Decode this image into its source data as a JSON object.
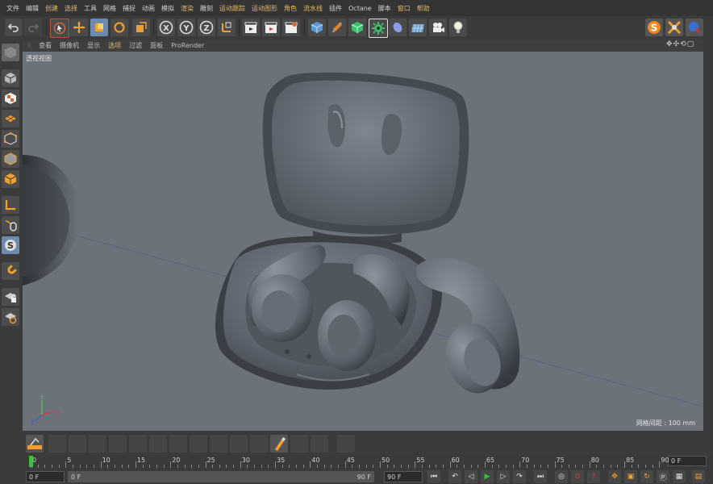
{
  "menu": [
    "文件",
    "编辑",
    "创建",
    "选择",
    "工具",
    "网格",
    "捕捉",
    "动画",
    "模拟",
    "渲染",
    "雕刻",
    "运动跟踪",
    "运动图形",
    "角色",
    "流水线",
    "插件",
    "Octane",
    "脚本",
    "窗口",
    "帮助"
  ],
  "menu_highlight": [
    "创建",
    "选择",
    "渲染",
    "运动跟踪",
    "运动图形",
    "角色",
    "流水线",
    "窗口",
    "帮助"
  ],
  "viewport_menu": [
    "查看",
    "摄像机",
    "显示",
    "选项",
    "过滤",
    "面板",
    "ProRender"
  ],
  "viewport_menu_active": "选项",
  "viewport": {
    "title": "透视视图",
    "grid_spacing": "网格间距 : 100 mm"
  },
  "axis_labels": {
    "x": "X",
    "y": "Y",
    "z": "Z"
  },
  "toolbar_axes": [
    "X",
    "Y",
    "Z"
  ],
  "timeline": {
    "ticks": [
      "0",
      "5",
      "10",
      "15",
      "20",
      "25",
      "30",
      "35",
      "40",
      "45",
      "50",
      "55",
      "60",
      "65",
      "70",
      "75",
      "80",
      "85",
      "90"
    ],
    "current_frame": "0 F"
  },
  "transport": {
    "start_field": "0 F",
    "range_start": "0 F",
    "range_end": "90 F",
    "end_field": "90 F"
  },
  "colors": {
    "accent": "#e9b85b",
    "viewport_bg": "#6b727a",
    "ui_bg": "#3b3b3b",
    "playhead": "#32c832"
  }
}
